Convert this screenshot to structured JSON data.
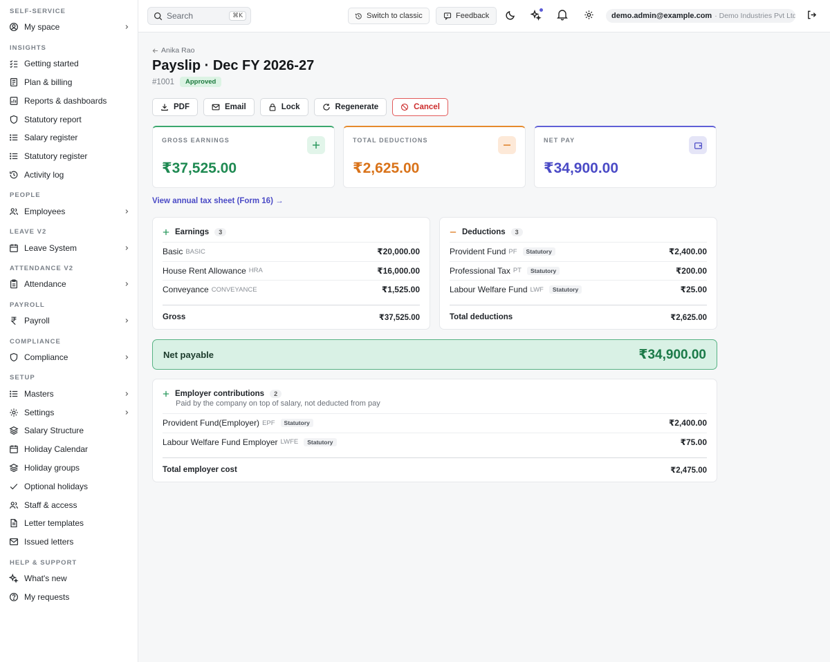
{
  "sidebar": {
    "sections": [
      {
        "title": "SELF-SERVICE",
        "items": [
          {
            "label": "My space",
            "icon": "user-circle-icon",
            "chevron": true
          }
        ]
      },
      {
        "title": "INSIGHTS",
        "items": [
          {
            "label": "Getting started",
            "icon": "checklist-icon"
          },
          {
            "label": "Plan & billing",
            "icon": "receipt-icon"
          },
          {
            "label": "Reports & dashboards",
            "icon": "report-icon"
          },
          {
            "label": "Statutory report",
            "icon": "shield-icon"
          },
          {
            "label": "Salary register",
            "icon": "list-icon"
          },
          {
            "label": "Statutory register",
            "icon": "list-icon"
          },
          {
            "label": "Activity log",
            "icon": "history-icon"
          }
        ]
      },
      {
        "title": "PEOPLE",
        "items": [
          {
            "label": "Employees",
            "icon": "users-icon",
            "chevron": true
          }
        ]
      },
      {
        "title": "LEAVE V2",
        "items": [
          {
            "label": "Leave System",
            "icon": "calendar-icon",
            "chevron": true
          }
        ]
      },
      {
        "title": "ATTENDANCE V2",
        "items": [
          {
            "label": "Attendance",
            "icon": "clipboard-icon",
            "chevron": true
          }
        ]
      },
      {
        "title": "PAYROLL",
        "items": [
          {
            "label": "Payroll",
            "icon": "rupee-icon",
            "chevron": true
          }
        ]
      },
      {
        "title": "COMPLIANCE",
        "items": [
          {
            "label": "Compliance",
            "icon": "shield-icon",
            "chevron": true
          }
        ]
      },
      {
        "title": "SETUP",
        "items": [
          {
            "label": "Masters",
            "icon": "list-icon",
            "chevron": true
          },
          {
            "label": "Settings",
            "icon": "gear-icon",
            "chevron": true
          },
          {
            "label": "Salary Structure",
            "icon": "layers-icon"
          },
          {
            "label": "Holiday Calendar",
            "icon": "calendar-icon"
          },
          {
            "label": "Holiday groups",
            "icon": "layers-icon"
          },
          {
            "label": "Optional holidays",
            "icon": "check-icon"
          },
          {
            "label": "Staff & access",
            "icon": "users-icon"
          },
          {
            "label": "Letter templates",
            "icon": "document-icon"
          },
          {
            "label": "Issued letters",
            "icon": "mail-icon"
          }
        ]
      },
      {
        "title": "HELP & SUPPORT",
        "items": [
          {
            "label": "What's new",
            "icon": "sparkle-icon"
          },
          {
            "label": "My requests",
            "icon": "help-circle-icon"
          }
        ]
      }
    ]
  },
  "header": {
    "search_placeholder": "Search",
    "search_shortcut": "⌘K",
    "switch_label": "Switch to classic",
    "feedback_label": "Feedback",
    "user_email": "demo.admin@example.com",
    "company": "· Demo Industries Pvt Ltd"
  },
  "page": {
    "back_label": "Anika Rao",
    "title": "Payslip · Dec FY 2026-27",
    "number": "#1001",
    "status": "Approved",
    "actions": {
      "pdf": "PDF",
      "email": "Email",
      "lock": "Lock",
      "regenerate": "Regenerate",
      "cancel": "Cancel"
    },
    "cards": [
      {
        "label": "GROSS EARNINGS",
        "value": "₹37,525.00"
      },
      {
        "label": "TOTAL DEDUCTIONS",
        "value": "₹2,625.00"
      },
      {
        "label": "NET PAY",
        "value": "₹34,900.00"
      }
    ],
    "tax_link": "View annual tax sheet (Form 16) →",
    "earnings": {
      "title": "Earnings",
      "count": "3",
      "rows": [
        {
          "name": "Basic",
          "code": "BASIC",
          "amount": "₹20,000.00"
        },
        {
          "name": "House Rent Allowance",
          "code": "HRA",
          "amount": "₹16,000.00"
        },
        {
          "name": "Conveyance",
          "code": "CONVEYANCE",
          "amount": "₹1,525.00"
        }
      ],
      "total_label": "Gross",
      "total": "₹37,525.00"
    },
    "deductions": {
      "title": "Deductions",
      "count": "3",
      "rows": [
        {
          "name": "Provident Fund",
          "code": "PF",
          "tag": "Statutory",
          "amount": "₹2,400.00"
        },
        {
          "name": "Professional Tax",
          "code": "PT",
          "tag": "Statutory",
          "amount": "₹200.00"
        },
        {
          "name": "Labour Welfare Fund",
          "code": "LWF",
          "tag": "Statutory",
          "amount": "₹25.00"
        }
      ],
      "total_label": "Total deductions",
      "total": "₹2,625.00"
    },
    "net": {
      "label": "Net payable",
      "value": "₹34,900.00"
    },
    "employer": {
      "title": "Employer contributions",
      "count": "2",
      "subtitle": "Paid by the company on top of salary, not deducted from pay",
      "rows": [
        {
          "name": "Provident Fund(Employer)",
          "code": "EPF",
          "tag": "Statutory",
          "amount": "₹2,400.00"
        },
        {
          "name": "Labour Welfare Fund Employer",
          "code": "LWFE",
          "tag": "Statutory",
          "amount": "₹75.00"
        }
      ],
      "total_label": "Total employer cost",
      "total": "₹2,475.00"
    }
  }
}
